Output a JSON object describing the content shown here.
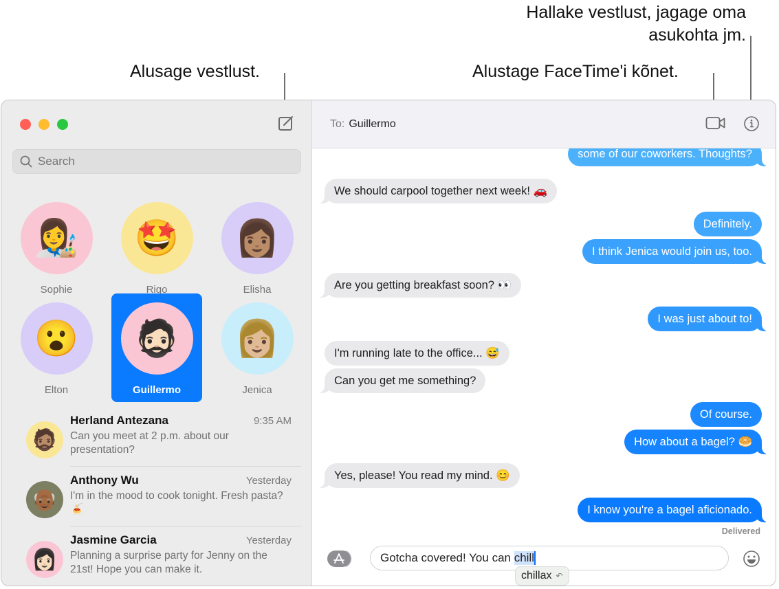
{
  "callouts": {
    "new_conversation": "Alusage vestlust.",
    "facetime": "Alustage FaceTime'i kõnet.",
    "details_line1": "Hallake vestlust, jagage oma",
    "details_line2": "asukohta jm."
  },
  "window": {
    "traffic_lights": {
      "close": "#ff5f57",
      "minimize": "#febc2e",
      "zoom": "#28c840"
    }
  },
  "sidebar": {
    "search_placeholder": "Search",
    "pinned": [
      {
        "name": "Sophie",
        "bg": "#fbc6d3",
        "emoji": "👩‍🎨"
      },
      {
        "name": "Rigo",
        "bg": "#fae796",
        "emoji": "🤩"
      },
      {
        "name": "Elisha",
        "bg": "#d8cdf8",
        "emoji": "👩🏽"
      },
      {
        "name": "Elton",
        "bg": "#d8cdf8",
        "emoji": "😮"
      },
      {
        "name": "Guillermo",
        "bg": "#fbc6d3",
        "emoji": "🧔🏻",
        "selected": true
      },
      {
        "name": "Jenica",
        "bg": "#c8eefc",
        "emoji": "👩🏼"
      }
    ],
    "conversations": [
      {
        "name": "Herland Antezana",
        "time": "9:35 AM",
        "preview": "Can you meet at 2 p.m. about our presentation?",
        "bg": "#fae796",
        "emoji": "🧔🏽"
      },
      {
        "name": "Anthony Wu",
        "time": "Yesterday",
        "preview": "I'm in the mood to cook tonight. Fresh pasta? 🍝",
        "bg": "#7c7f62",
        "emoji": "👴🏾"
      },
      {
        "name": "Jasmine Garcia",
        "time": "Yesterday",
        "preview": "Planning a surprise party for Jenny on the 21st! Hope you can make it.",
        "bg": "#fbc6d3",
        "emoji": "👩🏻"
      }
    ]
  },
  "chat": {
    "to_label": "To:",
    "recipient": "Guillermo",
    "messages": [
      {
        "dir": "out",
        "text": "some of our coworkers. Thoughts?",
        "tail": true
      },
      {
        "dir": "in",
        "text": "We should carpool together next week! 🚗",
        "tail": true
      },
      {
        "dir": "out",
        "text": "Definitely.",
        "tail": false
      },
      {
        "dir": "out",
        "text": "I think Jenica would join us, too.",
        "tail": true
      },
      {
        "dir": "in",
        "text": "Are you getting breakfast soon? 👀",
        "tail": true
      },
      {
        "dir": "out",
        "text": "I was just about to!",
        "tail": true
      },
      {
        "dir": "in",
        "text": "I'm running late to the office... 😅",
        "tail": false
      },
      {
        "dir": "in",
        "text": "Can you get me something?",
        "tail": true
      },
      {
        "dir": "out",
        "text": "Of course.",
        "tail": false
      },
      {
        "dir": "out",
        "text": "How about a bagel? 🥯",
        "tail": true
      },
      {
        "dir": "in",
        "text": "Yes, please! You read my mind. 😊",
        "tail": true
      },
      {
        "dir": "out",
        "text": "I know you're a bagel aficionado.",
        "tail": true
      }
    ],
    "status": "Delivered",
    "input_text": "Gotcha covered! You can ",
    "input_highlight": "chill",
    "suggestion": "chillax",
    "colors": {
      "outgoing_light": "#4cb1fb",
      "outgoing_dark": "#0a7aff",
      "incoming": "#e9e9eb"
    }
  }
}
